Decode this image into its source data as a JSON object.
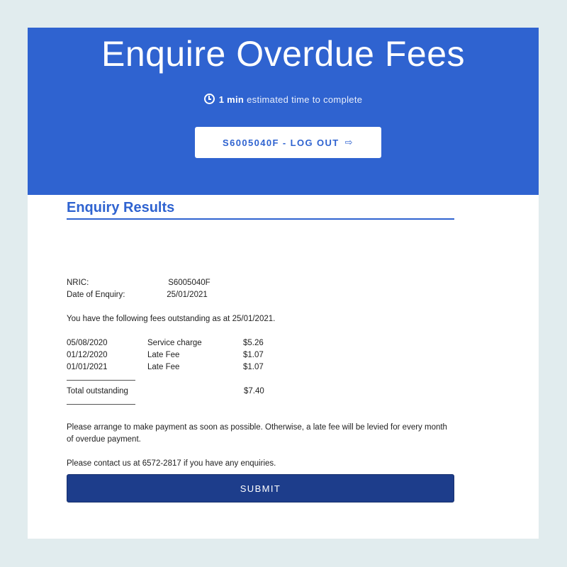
{
  "header": {
    "title": "Enquire Overdue Fees",
    "time_value": "1 min",
    "time_suffix": "estimated time to complete",
    "logout_label": "S6005040F - LOG OUT",
    "clock_icon": "clock-icon",
    "exit_icon": "exit-icon"
  },
  "results": {
    "section_title": "Enquiry Results",
    "nric_label": "NRIC:",
    "nric_value": "S6005040F",
    "date_label": "Date of Enquiry:",
    "date_value": "25/01/2021",
    "intro": "You have the following fees outstanding as at 25/01/2021.",
    "fees": [
      {
        "date": "05/08/2020",
        "type": "Service charge",
        "amount": "$5.26"
      },
      {
        "date": "01/12/2020",
        "type": "Late Fee",
        "amount": "$1.07"
      },
      {
        "date": "01/01/2021",
        "type": "Late Fee",
        "amount": "$1.07"
      }
    ],
    "total_label": "Total outstanding",
    "total_value": "$7.40",
    "payment_note": "Please arrange to make payment as soon as possible. Otherwise, a late fee will be levied for every month of overdue payment.",
    "contact_note": "Please contact us at 6572-2817 if you have any enquiries."
  },
  "actions": {
    "submit_label": "SUBMIT"
  },
  "colors": {
    "page_bg": "#e1ecee",
    "hero_bg": "#2f63d0",
    "accent": "#2f63d0",
    "submit_bg": "#1d3d8b"
  }
}
